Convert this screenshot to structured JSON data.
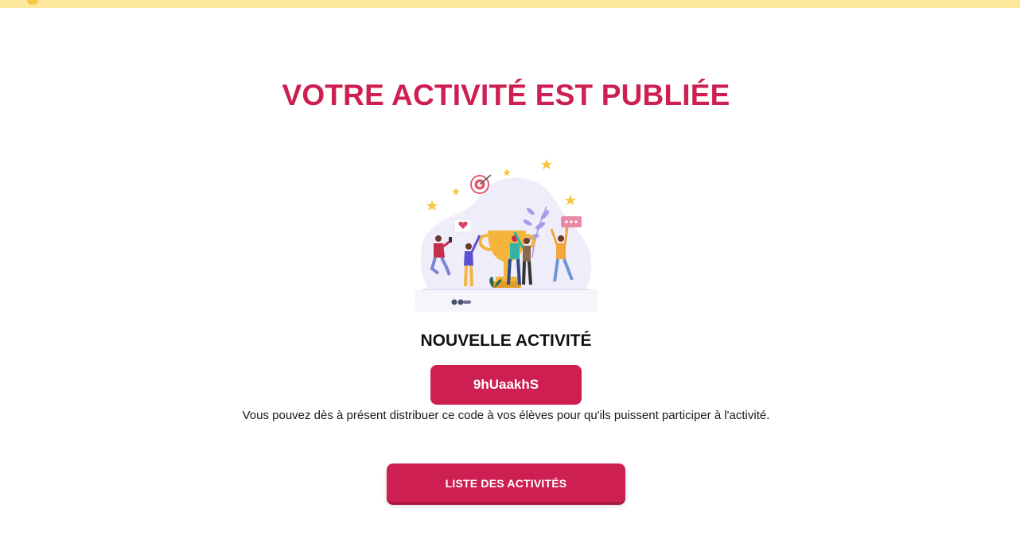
{
  "header": {
    "title": "VOTRE ACTIVITÉ EST PUBLIÉE"
  },
  "illustration": {
    "icon": "celebration-trophy-illustration"
  },
  "activity": {
    "name": "NOUVELLE ACTIVITÉ",
    "code": "9hUaakhS",
    "instructions": "Vous pouvez dès à présent distribuer ce code à vos élèves pour qu'ils puissent participer à l'activité."
  },
  "actions": {
    "list_button_label": "LISTE DES ACTIVITÉS"
  },
  "colors": {
    "accent": "#cd1f52",
    "banner": "#fde79c",
    "star": "#f6c742"
  }
}
